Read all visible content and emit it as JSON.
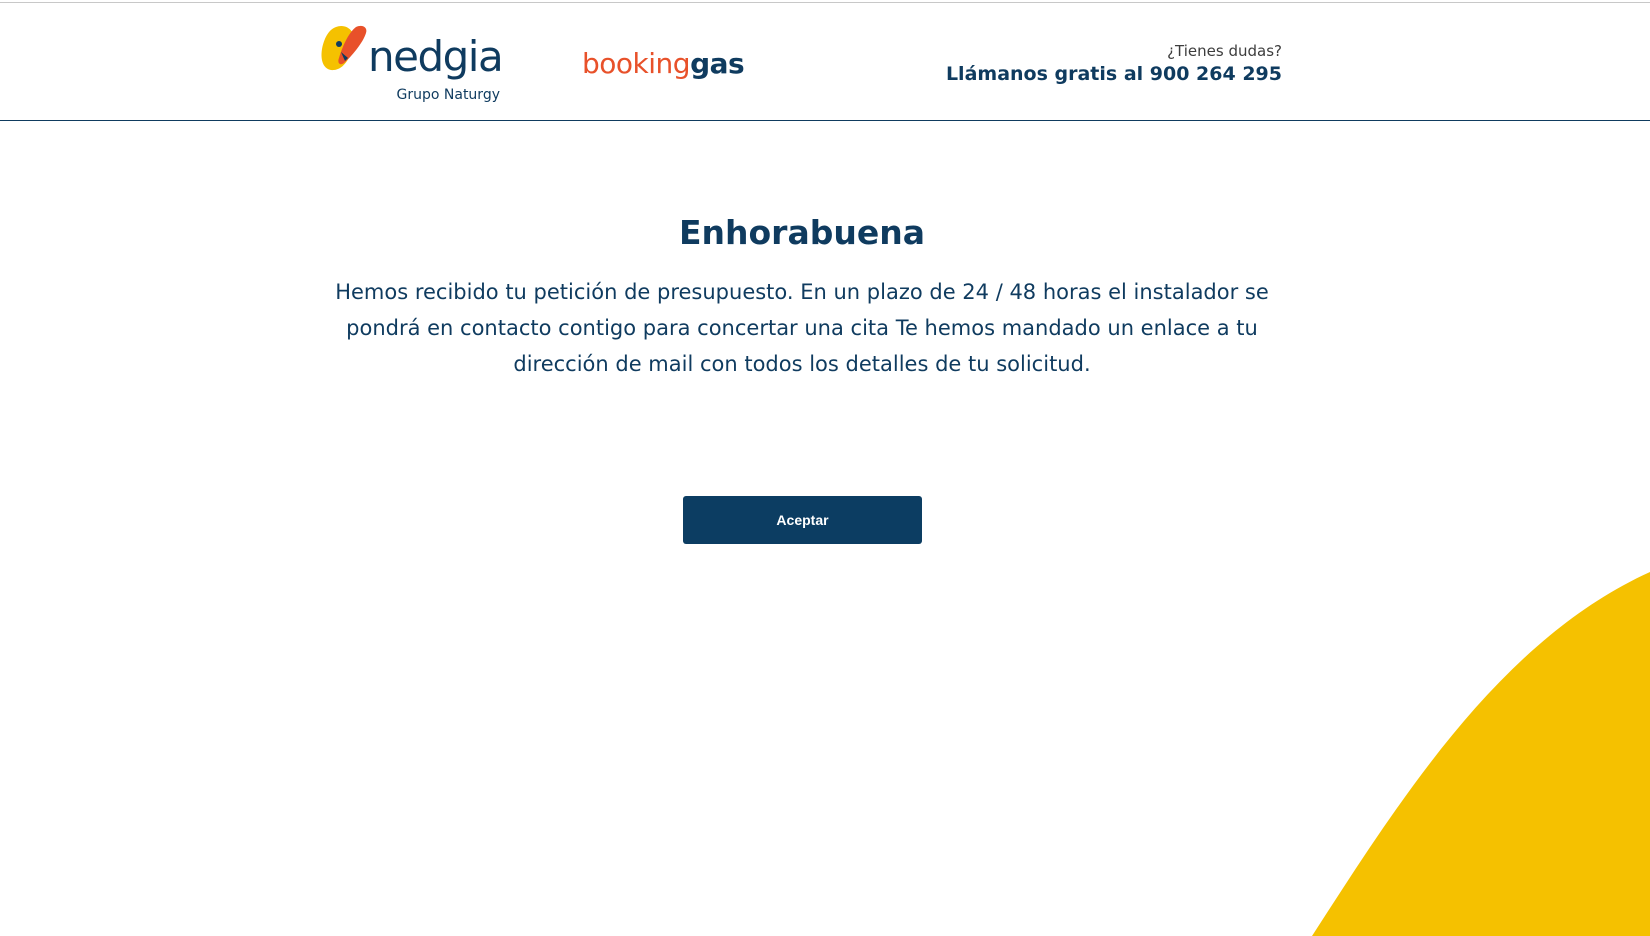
{
  "header": {
    "brand_logo": {
      "name": "nedgia",
      "subtitle": "Grupo Naturgy",
      "colors": {
        "yellow": "#f5c100",
        "red": "#e8512a",
        "navy": "#0f3b5f"
      }
    },
    "booking_logo": {
      "part1": "booking",
      "part2": "gas",
      "colors": {
        "part1": "#e8512a",
        "part2": "#0f3b5f"
      }
    },
    "contact": {
      "question": "¿Tienes dudas?",
      "phone_text": "Llámanos gratis al 900 264 295"
    }
  },
  "main": {
    "title": "Enhorabuena",
    "message": "Hemos recibido tu petición de presupuesto. En un plazo de 24 / 48 horas el instalador se pondrá en contacto contigo para concertar una cita Te hemos mandado un enlace a tu dirección de mail con todos los detalles de tu solicitud.",
    "accept_label": "Aceptar"
  },
  "theme": {
    "primary": "#0c3d62",
    "accent_yellow": "#f5c100",
    "accent_orange": "#e8512a"
  }
}
